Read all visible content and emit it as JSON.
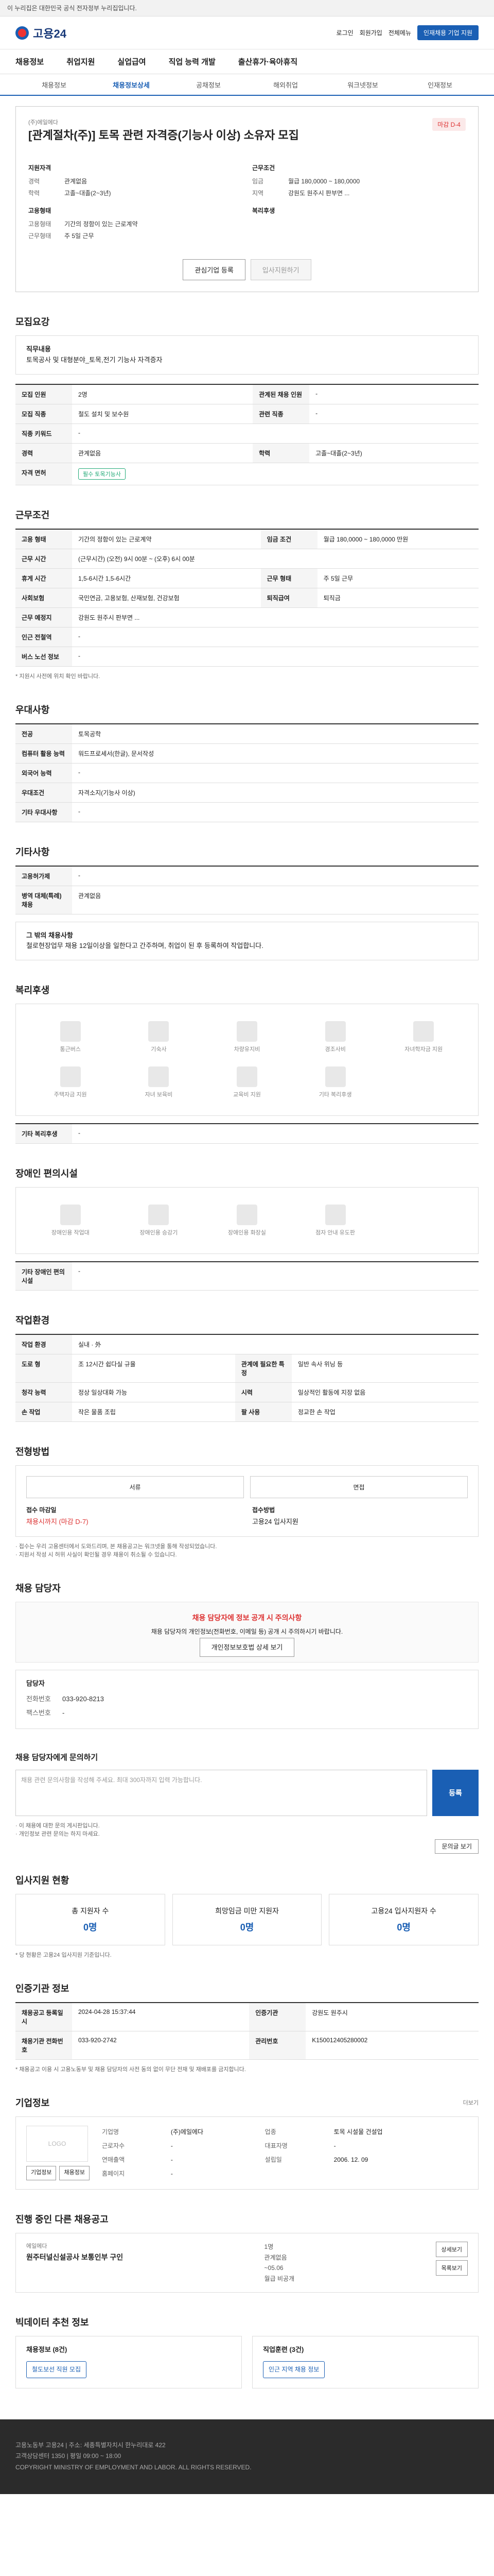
{
  "topbar": {
    "notice": "이 누리집은 대한민국 공식 전자정부 누리집입니다."
  },
  "header": {
    "logo_text": "고용24",
    "links": [
      "로그인",
      "회원가입",
      "전체메뉴"
    ],
    "cta": "인재채용 기업 지원"
  },
  "gnb": [
    "채용정보",
    "취업지원",
    "실업급여",
    "직업 능력 개발",
    "출산휴가·육아휴직"
  ],
  "subnav": [
    "채용정보",
    "채용정보상세",
    "공채정보",
    "해외취업",
    "워크넷정보",
    "인재정보"
  ],
  "subnav_active": 1,
  "job": {
    "company": "(주)에일에다",
    "title": "[관계절차(주)] 토목 관련 자격증(기능사 이상) 소유자 모집",
    "badge": "마감 D-4",
    "left_head": "지원자격",
    "left_rows": [
      [
        "경력",
        "관계없음"
      ],
      [
        "학력",
        "고졸~대졸(2~3년)"
      ]
    ],
    "left_head2": "고용형태",
    "left_rows2": [
      [
        "고용형태",
        "기간의 정함이 있는 근로계약"
      ],
      [
        "근무형태",
        "주 5일 근무"
      ]
    ],
    "right_head": "근무조건",
    "right_rows": [
      [
        "임금",
        "월급 180,0000 ~ 180,0000"
      ],
      [
        "지역",
        "강원도 원주시 판부면 ..."
      ]
    ],
    "right_head2": "복리후생",
    "btn_interest": "관심기업 등록",
    "btn_apply": "입사지원하기"
  },
  "sections": {
    "recruit_title": "모집요강",
    "job_desc_head": "직무내용",
    "job_desc": "토목공사 및 대형분야_토목,전기 기능사 자격증자",
    "recruit_table": [
      [
        "모집 인원",
        "2명",
        "관계된 채용 인원",
        "-"
      ],
      [
        "모집 직종",
        "철도 설치 및 보수원",
        "관련 직종",
        "-"
      ],
      [
        "직종 키워드",
        "-",
        "",
        ""
      ],
      [
        "경력",
        "관계없음",
        "학력",
        "고졸~대졸(2~3년)"
      ],
      [
        "자격 면허",
        "필수 토목기능사",
        "",
        ""
      ]
    ],
    "cond_title": "근무조건",
    "cond_table": [
      [
        "고용 형태",
        "기간의 정함이 있는 근로계약",
        "임금 조건",
        "월급 180,0000 ~ 180,0000 만원"
      ],
      [
        "근무 시간",
        "(근무시간) (오전) 9시 00분 ~ (오후) 6시 00분",
        "",
        ""
      ],
      [
        "휴게 시간",
        "1,5-6시간 1,5-6시간",
        "근무 형태",
        "주 5일 근무"
      ],
      [
        "사회보험",
        "국민연금, 고용보험, 산재보험, 건강보험",
        "퇴직급여",
        "퇴직금"
      ],
      [
        "근무 예정지",
        "강원도 원주시 판부면 ...",
        "",
        ""
      ],
      [
        "인근 전철역",
        "-",
        "",
        ""
      ],
      [
        "버스 노선 정보",
        "-",
        "",
        ""
      ]
    ],
    "cond_note": "* 지원시 사전에 위치 확인 바랍니다.",
    "etc_title": "우대사항",
    "etc_table": [
      [
        "전공",
        "토목공학"
      ],
      [
        "컴퓨터 활용 능력",
        "워드프로세서(한글), 문서작성"
      ],
      [
        "외국어 능력",
        "-"
      ],
      [
        "우대조건",
        "자격소지(기능사 이상)"
      ],
      [
        "기타 우대사항",
        "-"
      ]
    ],
    "other_title": "기타사항",
    "other_table": [
      [
        "고용허가제",
        "-"
      ],
      [
        "병역 대체(특례) 채용",
        "관계없음"
      ]
    ],
    "other_extra_head": "그 밖의 채용사항",
    "other_extra": "철로현장업무 채용 12일이상을 일한다고 간주하며, 취업이 된 후 등록하여 작업합니다.",
    "benefit_title": "복리후생",
    "benefit_icons": [
      "통근버스",
      "기숙사",
      "차량유지비",
      "경조사비",
      "자녀학자금 지원",
      "주택자금 지원",
      "자녀 보육비",
      "교육비 지원",
      "기타 복리후생",
      ""
    ],
    "benefit_other_head": "기타 복리후생",
    "benefit_other": "-",
    "dis_title": "장애인 편의시설",
    "dis_icons": [
      "장애인용 작업대",
      "장애인용 승강기",
      "장애인용 화장실",
      "점자 안내 유도판",
      ""
    ],
    "dis_other_head": "기타 장애인 편의시설",
    "dis_other": "-",
    "env_title": "작업환경",
    "env_table": [
      [
        "작업 환경",
        "실내 · 外",
        "",
        ""
      ],
      [
        "도로 형",
        "조 12시간 쉽다실 규율",
        "관계에 필요한 특정",
        "일반 속사 위닝 등"
      ],
      [
        "청각 능력",
        "정상 일상대화 가능",
        "시력",
        "일상적인 활동에 지장 없음"
      ],
      [
        "손 작업",
        "작은 물품 조립",
        "팔 사용",
        "정교한 손 작업"
      ]
    ],
    "apply_title": "전형방법",
    "apply_methods": [
      "서류",
      "면접"
    ],
    "apply_rows": [
      [
        "접수 마감일",
        "채용시까지 (마감 D-7)"
      ],
      [
        "접수방법",
        "고용24 입사지원"
      ]
    ],
    "apply_notes": [
      "· 접수는 우리 고용센터에서 도와드리며, 본 채용공고는 워크넷을 통해 작성되었습니다.",
      "· 지원서 작성 시 허위 사실이 확인될 경우 채용이 취소될 수 있습니다."
    ],
    "contact_title": "채용 담당자",
    "contact_warn_title": "채용 담당자에 정보 공개 시 주의사항",
    "contact_warn": "채용 담당자의 개인정보(전화번호, 이메일 등) 공개 시 주의하시기 바랍니다.",
    "contact_btn": "개인정보보호법 상세 보기",
    "contact_head": "담당자",
    "contact_rows": [
      [
        "전화번호",
        "033-920-8213"
      ],
      [
        "팩스번호",
        "-"
      ]
    ],
    "inquiry_title": "채용 담당자에게 문의하기",
    "inquiry_placeholder": "채용 관련 문의사항을 작성해 주세요. 최대 300자까지 입력 가능합니다.",
    "inquiry_submit": "등록",
    "inquiry_notes": [
      "· 이 채용에 대한 문의 게시판입니다.",
      "· 개인정보 관련 문의는 하지 마세요."
    ],
    "inquiry_list_btn": "문의글 보기",
    "stats_title": "입사지원 현황",
    "stats": [
      [
        "총 지원자 수",
        "0명"
      ],
      [
        "희망임금 미만 지원자",
        "0명"
      ],
      [
        "고용24 입사지원자 수",
        "0명"
      ]
    ],
    "stats_note": "* 당 현황은 고용24 입사지원 기준입니다.",
    "manage_title": "인증기관 정보",
    "manage_table": [
      [
        "채용공고 등록일시",
        "2024-04-28 15:37:44",
        "인증기관",
        "강원도 원주시"
      ],
      [
        "채용기관 전화번호",
        "033-920-2742",
        "관리번호",
        "K150012405280002"
      ]
    ],
    "manage_note": "* 채용공고 이용 시 고용노동부 및 채용 담당자의 사전 동의 없이 무단 전재 및 재배포를 금지합니다.",
    "company_title": "기업정보",
    "company_more": "더보기",
    "company_logo": "LOGO",
    "company_rows": [
      [
        "기업명",
        "(주)에일에다",
        "업종",
        "토목 시설물 건설업"
      ],
      [
        "근로자수",
        "-",
        "대표자명",
        "-"
      ],
      [
        "연매출액",
        "-",
        "설립일",
        "2006. 12. 09"
      ],
      [
        "홈페이지",
        "-",
        "",
        ""
      ]
    ],
    "company_btns": [
      "기업정보",
      "채용정보"
    ],
    "related_title": "진행 중인 다른 채용공고",
    "related_company": "에일에다",
    "related_job": "원주터널신설공사 보통인부 구인",
    "related_meta": [
      "1명",
      "관계없음",
      "~05.06",
      "월급 비공개"
    ],
    "related_btns": [
      "상세보기",
      "목록보기"
    ],
    "recommend_title": "빅데이터 추천 정보",
    "recommend_tabs": [
      "채용정보 (8건)",
      "직업훈련 (3건)"
    ],
    "recommend_items": [
      "철도보선 직원 모집",
      "인근 지역 채용 정보"
    ],
    "footer_lines": [
      "고용노동부 고용24 | 주소: 세종특별자치시 한누리대로 422",
      "고객상담센터 1350 | 평일 09:00 ~ 18:00",
      "COPYRIGHT MINISTRY OF EMPLOYMENT AND LABOR. ALL RIGHTS RESERVED."
    ]
  }
}
